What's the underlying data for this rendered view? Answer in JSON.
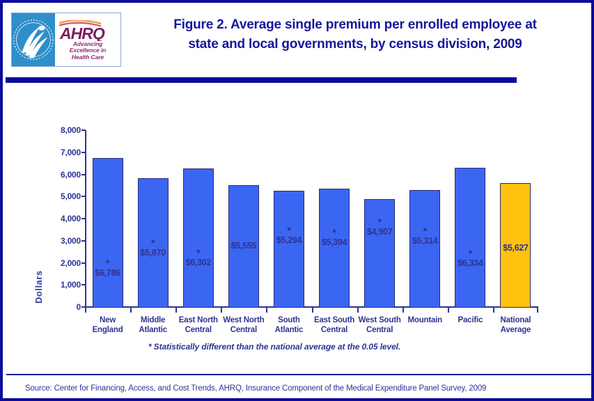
{
  "title": {
    "line1": "Figure 2. Average single premium per enrolled employee at",
    "line2": "state and local governments, by census division, 2009"
  },
  "logo": {
    "seal_alt": "hhs-seal-icon",
    "wordmark": "AHRQ",
    "tagline_line1": "Advancing",
    "tagline_line2": "Excellence in",
    "tagline_line3": "Health Care"
  },
  "footnote": "* Statistically different than the national average at the 0.05 level.",
  "source": "Source: Center for Financing, Access, and Cost Trends, AHRQ, Insurance Component of the Medical Expenditure Panel Survey,  2009",
  "colors": {
    "bar_blue": "#3b66f2",
    "bar_gold": "#ffc20e",
    "bar_outline": "#2a2a78",
    "text_navy": "#2f3392",
    "border_navy": "#0a0a9e",
    "title_navy": "#16179c"
  },
  "chart_data": {
    "type": "bar",
    "title": "Figure 2. Average single premium per enrolled employee at state and local governments, by census division, 2009",
    "xlabel": "",
    "ylabel": "Dollars",
    "ylim": [
      0,
      8000
    ],
    "ytick_values": [
      0,
      1000,
      2000,
      3000,
      4000,
      5000,
      6000,
      7000,
      8000
    ],
    "ytick_labels": [
      "0",
      "1,000",
      "2,000",
      "3,000",
      "4,000",
      "5,000",
      "6,000",
      "7,000",
      "8,000"
    ],
    "grid": false,
    "legend": false,
    "categories": [
      "New England",
      "Middle Atlantic",
      "East North Central",
      "West North Central",
      "South Atlantic",
      "East South Central",
      "West South Central",
      "Mountain",
      "Pacific",
      "National Average"
    ],
    "category_lines": [
      [
        "New",
        "England"
      ],
      [
        "Middle",
        "Atlantic"
      ],
      [
        "East North",
        "Central"
      ],
      [
        "West North",
        "Central"
      ],
      [
        "South",
        "Atlantic"
      ],
      [
        "East South",
        "Central"
      ],
      [
        "West South",
        "Central"
      ],
      [
        "Mountain",
        ""
      ],
      [
        "Pacific",
        ""
      ],
      [
        "National",
        "Average"
      ]
    ],
    "values": [
      6786,
      5870,
      6302,
      5555,
      5294,
      5394,
      4907,
      5314,
      6334,
      5627
    ],
    "value_labels": [
      "$6,786",
      "$5,870",
      "$6,302",
      "$5,555",
      "$5,294",
      "$5,394",
      "$4,907",
      "$5,314",
      "$6,334",
      "$5,627"
    ],
    "significant": [
      true,
      true,
      true,
      false,
      true,
      true,
      true,
      true,
      true,
      false
    ],
    "significance_marker": "*",
    "bar_colors": [
      "blue",
      "blue",
      "blue",
      "blue",
      "blue",
      "blue",
      "blue",
      "blue",
      "blue",
      "gold"
    ]
  }
}
